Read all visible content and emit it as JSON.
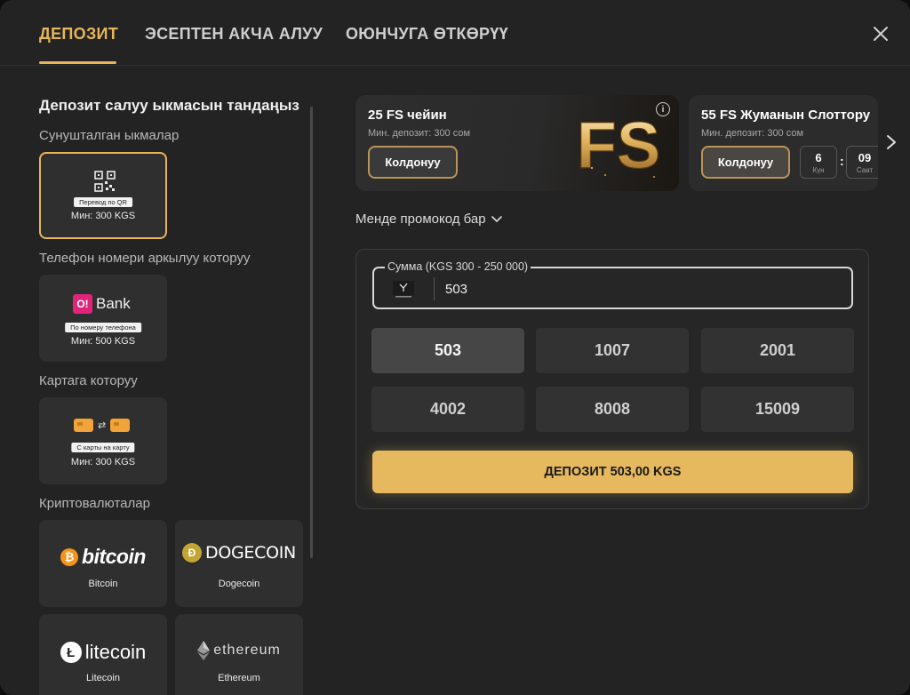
{
  "tabs": [
    {
      "label": "ДЕПОЗИТ"
    },
    {
      "label": "ЭСЕПТЕН АКЧА АЛУУ"
    },
    {
      "label": "ОЮНЧУГА ӨТКӨРҮҮ"
    }
  ],
  "left": {
    "title": "Депозит салуу ыкмасын тандаңыз",
    "sections": {
      "recommended": "Сунушталган ыкмалар",
      "phone": "Телефон номери аркылуу которуу",
      "card": "Картага которуу",
      "crypto": "Криптовалюталар"
    },
    "methods": {
      "qr": {
        "badge": "Перевод по QR",
        "caption": "Мин: 300 KGS"
      },
      "obank": {
        "logo_mark": "O!",
        "logo_text": "Bank",
        "badge": "По номеру телефона",
        "caption": "Мин: 500 KGS"
      },
      "card": {
        "swap_glyph": "⇄",
        "badge": "С карты на карту",
        "caption": "Мин: 300 KGS"
      },
      "bitcoin": {
        "logo_text": "bitcoin",
        "caption": "Bitcoin"
      },
      "dogecoin": {
        "logo_text": "DOGECOIN",
        "caption": "Dogecoin"
      },
      "litecoin": {
        "logo_text": "litecoin",
        "caption": "Litecoin"
      },
      "ethereum": {
        "logo_text": "ethereum",
        "caption": "Ethereum"
      }
    }
  },
  "promos": [
    {
      "title": "25 FS чейин",
      "subtitle": "Мин. депозит: 300 сом",
      "button": "Колдонуу",
      "art_text": "FS",
      "info_glyph": "i"
    },
    {
      "title": "55 FS Жуманын Слоттору",
      "subtitle": "Мин. депозит: 300 сом",
      "button": "Колдонуу",
      "timer": [
        {
          "value": "6",
          "unit": "Күн"
        },
        {
          "value": "09",
          "unit": "Саат"
        }
      ]
    }
  ],
  "promo_link": "Менде промокод бар",
  "amount": {
    "label": "Сумма (KGS 300 - 250 000)",
    "value": "503"
  },
  "quick_amounts": [
    "503",
    "1007",
    "2001",
    "4002",
    "8008",
    "15009"
  ],
  "deposit_button": "ДЕПОЗИТ 503,00 KGS",
  "colors": {
    "accent": "#e8b659",
    "background": "#232323",
    "card": "#2f2f2f"
  }
}
